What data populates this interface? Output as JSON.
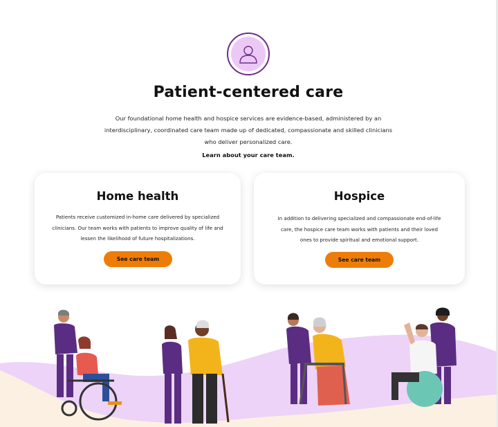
{
  "hero": {
    "icon": "person-icon",
    "title": "Patient-centered care",
    "intro": "Our foundational home health and hospice services are evidence-based, administered by an interdisciplinary, coordinated care team made up of dedicated, compassionate and skilled clinicians who deliver personalized care.",
    "learn_link": "Learn about your care team."
  },
  "cards": [
    {
      "title": "Home health",
      "body": "Patients receive customized in-home care delivered by specialized clinicians. Our team works with patients to improve quality of life and lessen the likelihood of future hospitalizations.",
      "button": "See care team"
    },
    {
      "title": "Hospice",
      "body": "In addition to delivering specialized and compassionate end-of-life care, the hospice care team works with patients and their loved ones to provide spiritual and emotional support.",
      "button": "See care team"
    }
  ],
  "colors": {
    "accent": "#ee7d08",
    "brand_purple": "#6b2d8c",
    "lavender": "#ecc8f6",
    "cream": "#fcf0e3"
  }
}
